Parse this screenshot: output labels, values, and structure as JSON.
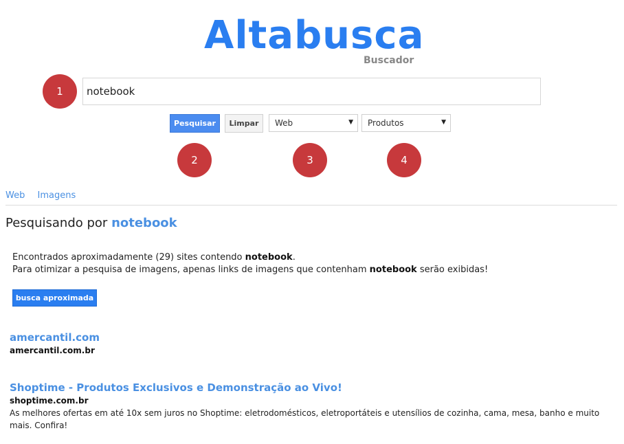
{
  "logo": {
    "title": "Altabusca",
    "subtitle": "Buscador"
  },
  "markers": [
    "1",
    "2",
    "3",
    "4"
  ],
  "search": {
    "value": "notebook",
    "placeholder": ""
  },
  "buttons": {
    "search": "Pesquisar",
    "clear": "Limpar",
    "approximate": "busca aproximada"
  },
  "selects": {
    "type": "Web",
    "category": "Produtos",
    "caret": "▼"
  },
  "tabs": [
    "Web",
    "Imagens"
  ],
  "searching": {
    "prefix": "Pesquisando por",
    "term": "notebook"
  },
  "info": {
    "line1_prefix": "Encontrados aproximadamente (29) sites contendo",
    "line1_term": "notebook",
    "line1_suffix": ".",
    "line2_prefix": "Para otimizar a pesquisa de imagens, apenas links de imagens que contenham",
    "line2_term": "notebook",
    "line2_suffix": "serão exibidas!"
  },
  "results": [
    {
      "title": "amercantil.com",
      "url": "amercantil.com.br",
      "desc": ""
    },
    {
      "title": "Shoptime - Produtos Exclusivos e Demonstração ao Vivo!",
      "url": "shoptime.com.br",
      "desc": "As melhores ofertas em até 10x sem juros no Shoptime: eletrodomésticos, eletroportáteis e utensílios de cozinha, cama, mesa, banho e muito mais. Confira!"
    }
  ],
  "colors": {
    "accent": "#2a7ef0",
    "link": "#4a90e2",
    "marker": "#c7393c"
  }
}
